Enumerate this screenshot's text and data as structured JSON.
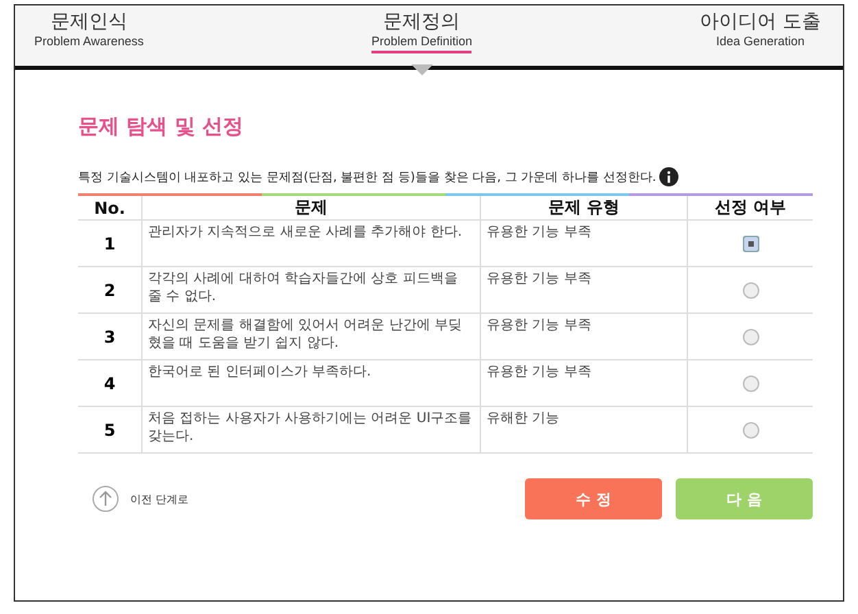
{
  "steps": [
    {
      "title": "문제인식",
      "subtitle": "Problem Awareness",
      "selected": false
    },
    {
      "title": "문제정의",
      "subtitle": "Problem Definition",
      "selected": true
    },
    {
      "title": "아이디어 도출",
      "subtitle": "Idea Generation",
      "selected": false
    }
  ],
  "heading": "문제 탐색 및 선정",
  "description": "특정 기술시스템이 내포하고 있는 문제점(단점, 불편한 점 등)들을 찾은 다음, 그 가운데 하나를 선정한다.",
  "table": {
    "columns": [
      "No.",
      "문제",
      "문제 유형",
      "선정 여부"
    ],
    "rows": [
      {
        "no": "1",
        "problem": "관리자가 지속적으로 새로운 사례를 추가해야 한다.",
        "type": "유용한 기능 부족",
        "selected": true
      },
      {
        "no": "2",
        "problem": "각각의 사례에 대하여 학습자들간에 상호 피드백을 줄 수 없다.",
        "type": "유용한 기능 부족",
        "selected": false
      },
      {
        "no": "3",
        "problem": "자신의 문제를 해결함에 있어서 어려운 난간에 부딪혔을 때 도움을 받기 쉽지 않다.",
        "type": "유용한 기능 부족",
        "selected": false
      },
      {
        "no": "4",
        "problem": "한국어로 된 인터페이스가 부족하다.",
        "type": "유용한 기능 부족",
        "selected": false
      },
      {
        "no": "5",
        "problem": "처음 접하는 사용자가 사용하기에는 어려운 UI구조를 갖는다.",
        "type": "유해한 기능",
        "selected": false
      }
    ]
  },
  "back_link": "이전 단계로",
  "buttons": [
    {
      "label": "수 정",
      "kind": "edit"
    },
    {
      "label": "다 음",
      "kind": "next"
    }
  ]
}
